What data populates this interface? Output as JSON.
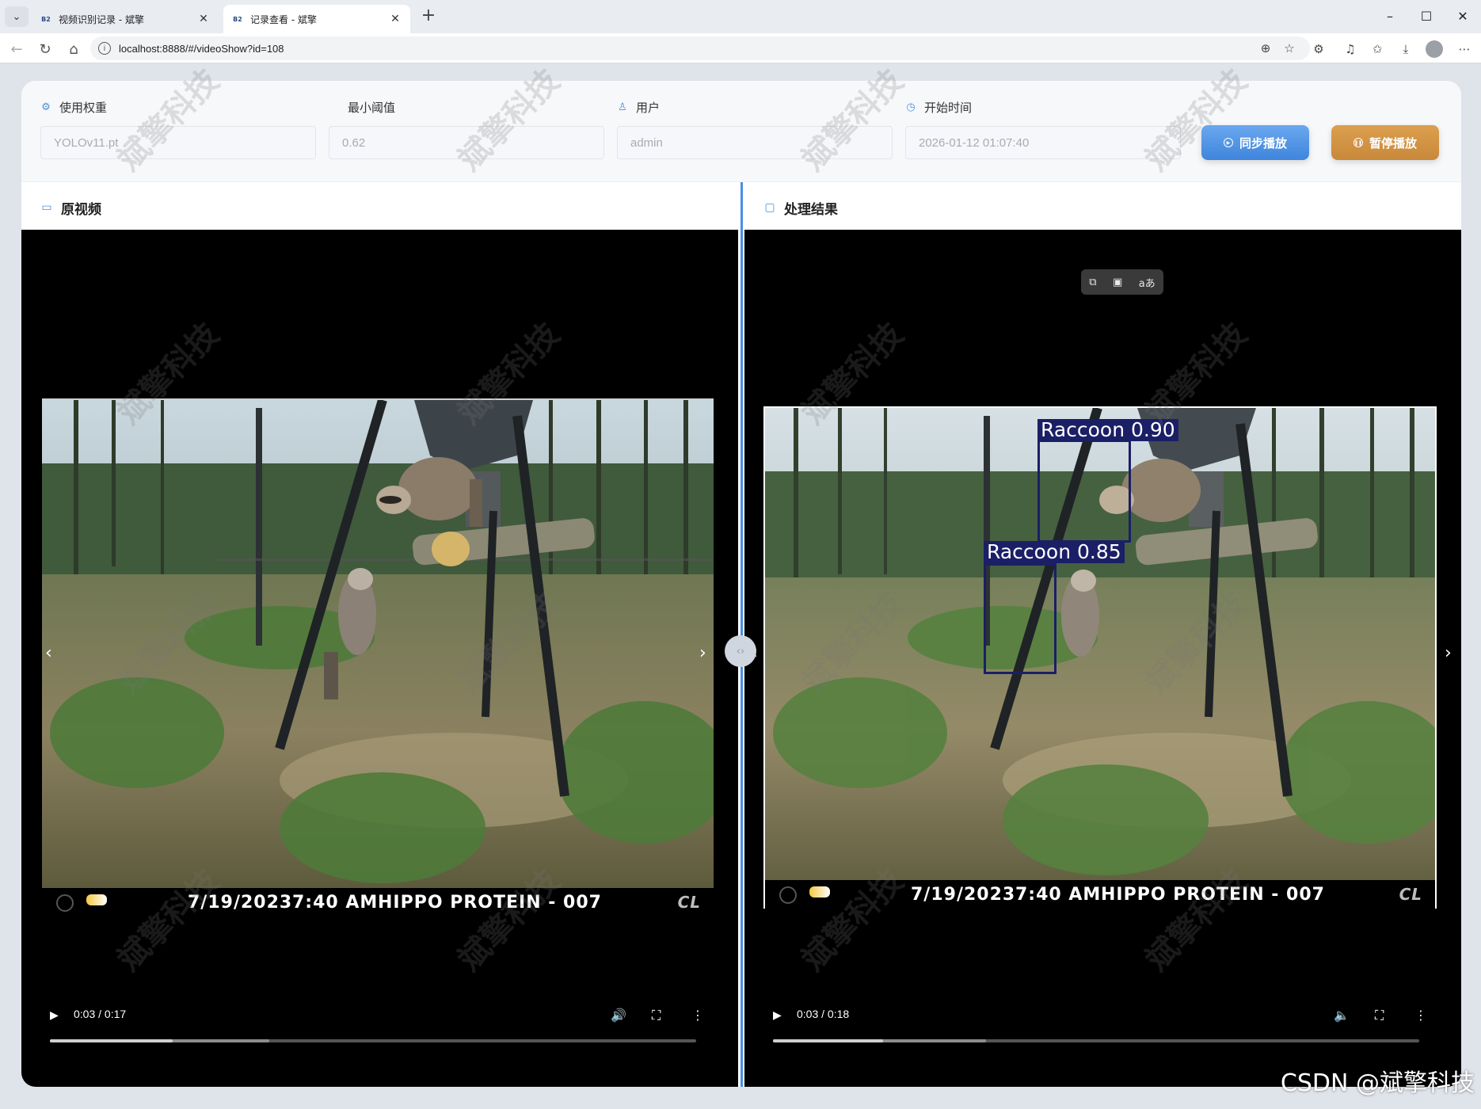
{
  "browser": {
    "tabs": [
      {
        "label": "视频识别记录 - 斌擎",
        "favicon": "B2",
        "active": false
      },
      {
        "label": "记录查看 - 斌擎",
        "favicon": "B2",
        "active": true
      }
    ],
    "url": "localhost:8888/#/videoShow?id=108",
    "icons": [
      "back-icon",
      "reload-icon",
      "home-icon",
      "info-icon",
      "zoom-icon",
      "star-icon",
      "extensions-icon",
      "media-icon",
      "favorites-icon",
      "downloads-icon",
      "profile-icon",
      "more-icon"
    ]
  },
  "form": {
    "weight": {
      "label": "使用权重",
      "value": "YOLOv11.pt",
      "icon": "cpu-icon"
    },
    "threshold": {
      "label": "最小阈值",
      "value": "0.62"
    },
    "user": {
      "label": "用户",
      "value": "admin",
      "icon": "user-icon"
    },
    "start_time": {
      "label": "开始时间",
      "value": "2026-01-12 01:07:40",
      "icon": "clock-icon"
    },
    "sync_button": "同步播放",
    "pause_button": "暂停播放",
    "colors": {
      "sync": "#4a8fe3",
      "pause": "#d39340"
    }
  },
  "panels": {
    "original": {
      "title": "原视频",
      "icon": "video-camera-icon",
      "stamp": {
        "date": "7/19/2023",
        "time": "7:40 AM",
        "camera": "HIPPO PROTEIN - 007",
        "logo": "CL"
      },
      "player": {
        "time": "0:03 / 0:17",
        "progress": 0.19,
        "buffered": 0.34
      }
    },
    "result": {
      "title": "处理结果",
      "icon": "monitor-icon",
      "stamp": {
        "date": "7/19/2023",
        "time": "7:40 AM",
        "camera": "HIPPO PROTEIN - 007",
        "logo": "CL"
      },
      "player": {
        "time": "0:03 / 0:18",
        "progress": 0.17,
        "buffered": 0.33
      },
      "detections": [
        {
          "label": "Raccoon 0.90",
          "class": "Raccoon",
          "score": 0.9
        },
        {
          "label": "Raccoon 0.85",
          "class": "Raccoon",
          "score": 0.85
        }
      ],
      "overlay_tools": [
        "pip-icon",
        "visual-search-icon",
        "translate-icon"
      ]
    }
  },
  "watermark": "斌擎科技",
  "footer_watermark": "CSDN @斌擎科技"
}
